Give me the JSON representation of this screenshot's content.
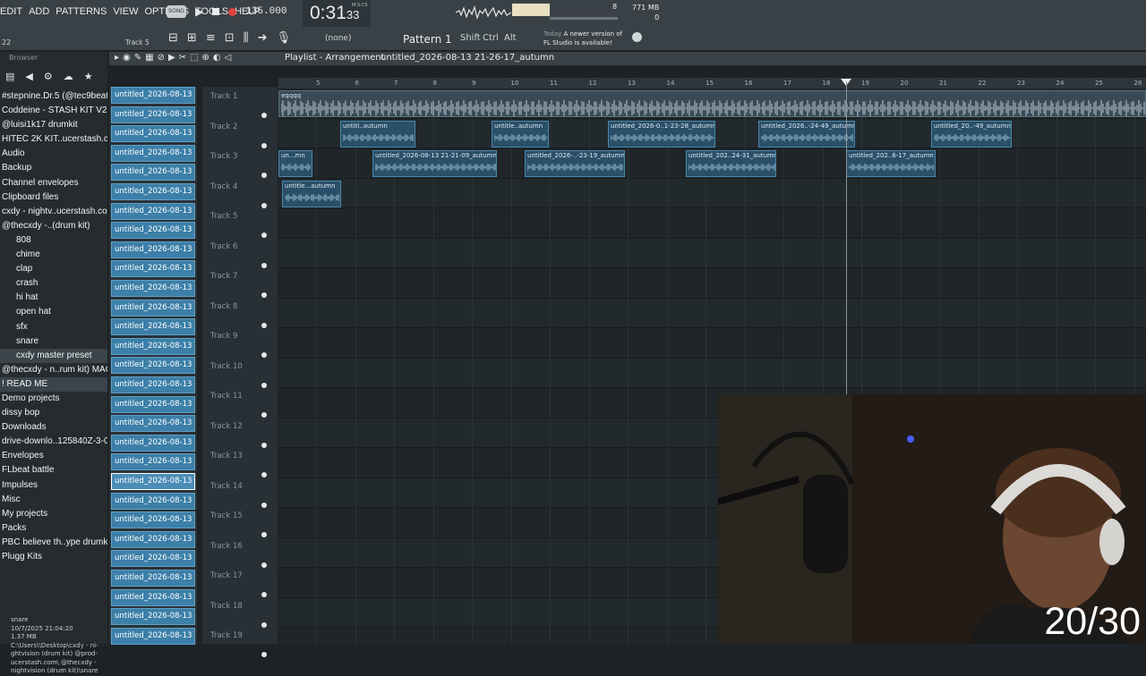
{
  "menu": [
    "EDIT",
    "ADD",
    "PATTERNS",
    "VIEW",
    "OPTIONS",
    "TOOLS",
    "HELP"
  ],
  "transport": {
    "mode": "SONG",
    "tempo": "135.000"
  },
  "time": {
    "main": "0:31",
    "sub": "33",
    "unit": "M:S:CS"
  },
  "cpu": {
    "mem": "771 MB",
    "voices": "0",
    "poly": "8"
  },
  "toolbar": {
    "track_label": "Track 5",
    "none_label": "(none)",
    "pattern": "Pattern 1",
    "shift": "Shift",
    "ctrl": "Ctrl",
    "alt": "Alt",
    "news_title": "Today",
    "news_line1": "A newer version of",
    "news_line2": "FL Studio is available!",
    "snap": "22"
  },
  "browser": {
    "title": "Browser",
    "items": [
      {
        "label": "#stepnine.Dr.5 (@tec9beat)",
        "sub": false
      },
      {
        "label": "Coddeine - STASH KIT V2 I",
        "sub": false
      },
      {
        "label": "@luisi1k17 drumkit",
        "sub": false
      },
      {
        "label": "HITEC 2K KIT..ucerstash.com",
        "sub": false
      },
      {
        "label": "Audio",
        "sub": false
      },
      {
        "label": "Backup",
        "sub": false
      },
      {
        "label": "Channel envelopes",
        "sub": false
      },
      {
        "label": "Clipboard files",
        "sub": false
      },
      {
        "label": "cxdy - nightv..ucerstash.com",
        "sub": false
      },
      {
        "label": "@thecxdy -..(drum kit)",
        "sub": false
      },
      {
        "label": "808",
        "sub": true
      },
      {
        "label": "chime",
        "sub": true
      },
      {
        "label": "clap",
        "sub": true
      },
      {
        "label": "crash",
        "sub": true
      },
      {
        "label": "hi hat",
        "sub": true
      },
      {
        "label": "open hat",
        "sub": true
      },
      {
        "label": "sfx",
        "sub": true
      },
      {
        "label": "snare",
        "sub": true
      },
      {
        "label": "cxdy master preset",
        "sub": true,
        "hl": true
      },
      {
        "label": "@thecxdy - n..rum kit) MAC",
        "sub": false
      },
      {
        "label": "! READ ME",
        "sub": false,
        "hl": true
      },
      {
        "label": "Demo projects",
        "sub": false
      },
      {
        "label": "dissy bop",
        "sub": false
      },
      {
        "label": "Downloads",
        "sub": false
      },
      {
        "label": "drive-downlo..125840Z-3-001",
        "sub": false
      },
      {
        "label": "Envelopes",
        "sub": false
      },
      {
        "label": "FLbeat battle",
        "sub": false
      },
      {
        "label": "Impulses",
        "sub": false
      },
      {
        "label": "Misc",
        "sub": false
      },
      {
        "label": "My projects",
        "sub": false
      },
      {
        "label": "Packs",
        "sub": false
      },
      {
        "label": "PBC believe th..ype drumkit 1",
        "sub": false
      },
      {
        "label": "Plugg Kits",
        "sub": false
      }
    ],
    "info": [
      "snare",
      "10/7/2025 21:04:20",
      "1.37 MB",
      "C:\\Users\\\\Desktop\\cxdy - ni-",
      "ghtvision (drum kit) @prod-",
      "ucerstash.com\\ @thecxdy -",
      "nightvision (drum kit)\\snare"
    ]
  },
  "playlist": {
    "title": "Playlist - Arrangement",
    "file": "untitled_2026-08-13 21-26-17_autumn"
  },
  "clip_list": [
    "untitled_2026-08-13 21-",
    "untitled_2026-08-13 21-",
    "untitled_2026-08-13 21-",
    "untitled_2026-08-13 21-",
    "untitled_2026-08-13 21-",
    "untitled_2026-08-13 21-",
    "untitled_2026-08-13 21-",
    "untitled_2026-08-13 21-",
    "untitled_2026-08-13 21-",
    "untitled_2026-08-13 21-",
    "untitled_2026-08-13 21-",
    "untitled_2026-08-13 21-",
    "untitled_2026-08-13 21-",
    "untitled_2026-08-13 21-",
    "untitled_2026-08-13 21-",
    "untitled_2026-08-13 21-",
    "untitled_2026-08-13 21-",
    "untitled_2026-08-13 21-",
    "untitled_2026-08-13 21-",
    "untitled_2026-08-13 21-",
    "untitled_2026-08-13 21-",
    "untitled_2026-08-13 21-",
    "untitled_2026-08-13 21-",
    "untitled_2026-08-13 21-",
    "untitled_2026-08-13 21-",
    "untitled_2026-08-13 21-",
    "untitled_2026-08-13 21-",
    "untitled_2026-08-13 21-",
    "untitled_2026-08-13 21-"
  ],
  "tracks": [
    "Track 1",
    "Track 2",
    "Track 3",
    "Track 4",
    "Track 5",
    "Track 6",
    "Track 7",
    "Track 8",
    "Track 9",
    "Track 10",
    "Track 11",
    "Track 12",
    "Track 13",
    "Track 14",
    "Track 15",
    "Track 16",
    "Track 17",
    "Track 18",
    "Track 19"
  ],
  "ruler": [
    "5",
    "6",
    "7",
    "8",
    "9",
    "10",
    "11",
    "12",
    "13",
    "14",
    "15",
    "16",
    "17",
    "18",
    "19",
    "20",
    "21",
    "22",
    "23",
    "24",
    "25",
    "26"
  ],
  "clips": [
    {
      "label": "eqqqq"
    },
    {
      "label": "untitl..autumn"
    },
    {
      "label": "untitle..autumn"
    },
    {
      "label": "untitled_2026-0..1-23-28_autumn"
    },
    {
      "label": "untitled_2026..-24-49_autumn"
    },
    {
      "label": "untitled_20..-49_autumn"
    },
    {
      "label": "un...mn"
    },
    {
      "label": "untitled_2026-08-13 21-21-09_autumn"
    },
    {
      "label": "untitled_2026-..-23-19_autumn"
    },
    {
      "label": "untitled_202..24-31_autumn"
    },
    {
      "label": "untitled_202..6-17_autumn"
    },
    {
      "label": "untitle...autumn"
    }
  ],
  "overlay": {
    "counter": "20/30"
  }
}
